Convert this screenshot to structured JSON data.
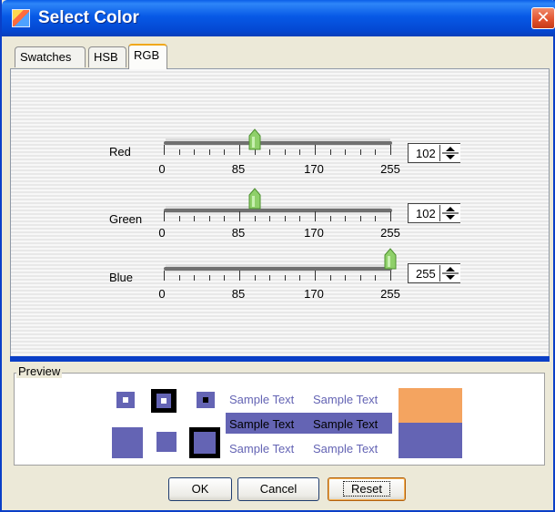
{
  "dialog": {
    "title": "Select Color",
    "close_symbol": "✕"
  },
  "tabs": [
    {
      "label": "Swatches",
      "active": false
    },
    {
      "label": "HSB",
      "active": false
    },
    {
      "label": "RGB",
      "active": true
    }
  ],
  "sliders": [
    {
      "label": "Red",
      "value": 102,
      "display": "102"
    },
    {
      "label": "Green",
      "value": 102,
      "display": "102"
    },
    {
      "label": "Blue",
      "value": 255,
      "display": "255"
    }
  ],
  "slider_scale": {
    "min": 0,
    "max": 255,
    "labels": [
      "0",
      "85",
      "170",
      "255"
    ]
  },
  "preview": {
    "label": "Preview",
    "sample_text": "Sample Text",
    "color": "#6666ff",
    "color_hex_shown": "#6464b4",
    "complement_color": "#f4a460"
  },
  "buttons": {
    "ok": "OK",
    "cancel": "Cancel",
    "reset": "Reset"
  },
  "colors": {
    "title_bar": "#0a5ee8",
    "preview_swatch": "#6464b4",
    "orange_swatch": "#f4a460"
  }
}
